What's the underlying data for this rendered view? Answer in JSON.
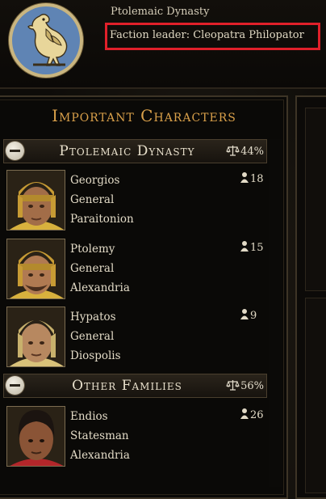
{
  "faction": {
    "name": "Ptolemaic Dynasty",
    "leader_label": "Faction leader:",
    "leader_name": "Cleopatra Philopator",
    "emblem_icon": "eagle-emblem-icon"
  },
  "panel": {
    "title": "Important Characters"
  },
  "groups": [
    {
      "name": "Ptolemaic Dynasty",
      "percent": "44%"
    },
    {
      "name": "Other Families",
      "percent": "56%"
    }
  ],
  "characters": [
    {
      "name": "Georgios",
      "role": "General",
      "location": "Paraitonion",
      "influence": "18"
    },
    {
      "name": "Ptolemy",
      "role": "General",
      "location": "Alexandria",
      "influence": "15"
    },
    {
      "name": "Hypatos",
      "role": "General",
      "location": "Diospolis",
      "influence": "9"
    },
    {
      "name": "Endios",
      "role": "Statesman",
      "location": "Alexandria",
      "influence": "26"
    }
  ],
  "colors": {
    "highlight_box": "#e0202a",
    "title_gold": "#d9a04a",
    "emblem_blue": "#5f84b4"
  }
}
